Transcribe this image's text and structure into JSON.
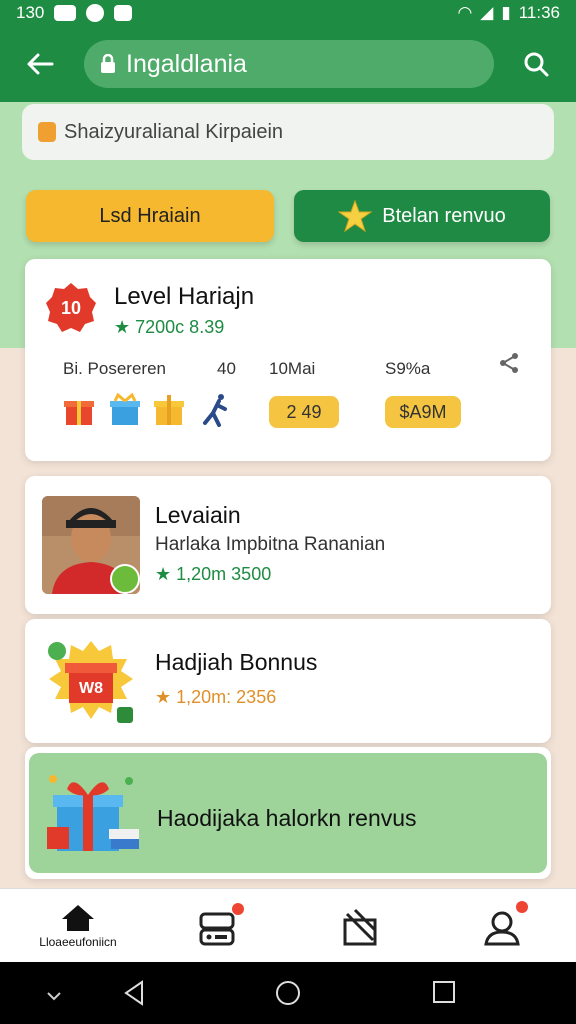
{
  "status": {
    "time_left": "130",
    "time_right": "11:36"
  },
  "header": {
    "title": "Ingaldlania"
  },
  "notice": {
    "text": "Shaizyuralianal Kirpaiein"
  },
  "actions": {
    "left_label": "Lsd Hraiain",
    "right_label": "Btelan renvuo"
  },
  "level_card": {
    "badge": "10",
    "title": "Level Hariajn",
    "subtitle": "★ 7200c 8.39",
    "stats": {
      "label_a": "Bi. Posereren",
      "label_b": "40",
      "label_c": "10Mai",
      "label_d": "S9%a"
    },
    "pill_left": "2 49",
    "pill_right": "$A9M"
  },
  "profile_card": {
    "title": "Levaiain",
    "subtitle": "Harlaka Impbitna Rananian",
    "meta": "★ 1,20m 3500"
  },
  "bonus_card": {
    "title": "Hadjiah Bonnus",
    "meta": "★ 1,20m: 2356",
    "badge_text": "W8"
  },
  "gift_card": {
    "title": "Haodijaka halorkn renvus"
  },
  "bottom_nav": [
    {
      "label": "Lloaeeufoniicn"
    },
    {
      "label": ""
    },
    {
      "label": ""
    },
    {
      "label": ""
    }
  ],
  "colors": {
    "primary": "#1e8c42",
    "accent_yellow": "#f5b82e",
    "band": "#b3e0b0"
  }
}
